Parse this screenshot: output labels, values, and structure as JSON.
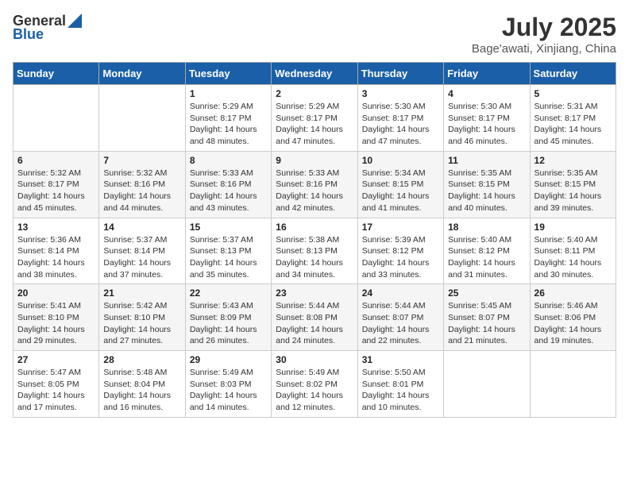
{
  "logo": {
    "general": "General",
    "blue": "Blue"
  },
  "title": "July 2025",
  "location": "Bage'awati, Xinjiang, China",
  "days_of_week": [
    "Sunday",
    "Monday",
    "Tuesday",
    "Wednesday",
    "Thursday",
    "Friday",
    "Saturday"
  ],
  "weeks": [
    [
      {
        "day": "",
        "info": ""
      },
      {
        "day": "",
        "info": ""
      },
      {
        "day": "1",
        "info": "Sunrise: 5:29 AM\nSunset: 8:17 PM\nDaylight: 14 hours and 48 minutes."
      },
      {
        "day": "2",
        "info": "Sunrise: 5:29 AM\nSunset: 8:17 PM\nDaylight: 14 hours and 47 minutes."
      },
      {
        "day": "3",
        "info": "Sunrise: 5:30 AM\nSunset: 8:17 PM\nDaylight: 14 hours and 47 minutes."
      },
      {
        "day": "4",
        "info": "Sunrise: 5:30 AM\nSunset: 8:17 PM\nDaylight: 14 hours and 46 minutes."
      },
      {
        "day": "5",
        "info": "Sunrise: 5:31 AM\nSunset: 8:17 PM\nDaylight: 14 hours and 45 minutes."
      }
    ],
    [
      {
        "day": "6",
        "info": "Sunrise: 5:32 AM\nSunset: 8:17 PM\nDaylight: 14 hours and 45 minutes."
      },
      {
        "day": "7",
        "info": "Sunrise: 5:32 AM\nSunset: 8:16 PM\nDaylight: 14 hours and 44 minutes."
      },
      {
        "day": "8",
        "info": "Sunrise: 5:33 AM\nSunset: 8:16 PM\nDaylight: 14 hours and 43 minutes."
      },
      {
        "day": "9",
        "info": "Sunrise: 5:33 AM\nSunset: 8:16 PM\nDaylight: 14 hours and 42 minutes."
      },
      {
        "day": "10",
        "info": "Sunrise: 5:34 AM\nSunset: 8:15 PM\nDaylight: 14 hours and 41 minutes."
      },
      {
        "day": "11",
        "info": "Sunrise: 5:35 AM\nSunset: 8:15 PM\nDaylight: 14 hours and 40 minutes."
      },
      {
        "day": "12",
        "info": "Sunrise: 5:35 AM\nSunset: 8:15 PM\nDaylight: 14 hours and 39 minutes."
      }
    ],
    [
      {
        "day": "13",
        "info": "Sunrise: 5:36 AM\nSunset: 8:14 PM\nDaylight: 14 hours and 38 minutes."
      },
      {
        "day": "14",
        "info": "Sunrise: 5:37 AM\nSunset: 8:14 PM\nDaylight: 14 hours and 37 minutes."
      },
      {
        "day": "15",
        "info": "Sunrise: 5:37 AM\nSunset: 8:13 PM\nDaylight: 14 hours and 35 minutes."
      },
      {
        "day": "16",
        "info": "Sunrise: 5:38 AM\nSunset: 8:13 PM\nDaylight: 14 hours and 34 minutes."
      },
      {
        "day": "17",
        "info": "Sunrise: 5:39 AM\nSunset: 8:12 PM\nDaylight: 14 hours and 33 minutes."
      },
      {
        "day": "18",
        "info": "Sunrise: 5:40 AM\nSunset: 8:12 PM\nDaylight: 14 hours and 31 minutes."
      },
      {
        "day": "19",
        "info": "Sunrise: 5:40 AM\nSunset: 8:11 PM\nDaylight: 14 hours and 30 minutes."
      }
    ],
    [
      {
        "day": "20",
        "info": "Sunrise: 5:41 AM\nSunset: 8:10 PM\nDaylight: 14 hours and 29 minutes."
      },
      {
        "day": "21",
        "info": "Sunrise: 5:42 AM\nSunset: 8:10 PM\nDaylight: 14 hours and 27 minutes."
      },
      {
        "day": "22",
        "info": "Sunrise: 5:43 AM\nSunset: 8:09 PM\nDaylight: 14 hours and 26 minutes."
      },
      {
        "day": "23",
        "info": "Sunrise: 5:44 AM\nSunset: 8:08 PM\nDaylight: 14 hours and 24 minutes."
      },
      {
        "day": "24",
        "info": "Sunrise: 5:44 AM\nSunset: 8:07 PM\nDaylight: 14 hours and 22 minutes."
      },
      {
        "day": "25",
        "info": "Sunrise: 5:45 AM\nSunset: 8:07 PM\nDaylight: 14 hours and 21 minutes."
      },
      {
        "day": "26",
        "info": "Sunrise: 5:46 AM\nSunset: 8:06 PM\nDaylight: 14 hours and 19 minutes."
      }
    ],
    [
      {
        "day": "27",
        "info": "Sunrise: 5:47 AM\nSunset: 8:05 PM\nDaylight: 14 hours and 17 minutes."
      },
      {
        "day": "28",
        "info": "Sunrise: 5:48 AM\nSunset: 8:04 PM\nDaylight: 14 hours and 16 minutes."
      },
      {
        "day": "29",
        "info": "Sunrise: 5:49 AM\nSunset: 8:03 PM\nDaylight: 14 hours and 14 minutes."
      },
      {
        "day": "30",
        "info": "Sunrise: 5:49 AM\nSunset: 8:02 PM\nDaylight: 14 hours and 12 minutes."
      },
      {
        "day": "31",
        "info": "Sunrise: 5:50 AM\nSunset: 8:01 PM\nDaylight: 14 hours and 10 minutes."
      },
      {
        "day": "",
        "info": ""
      },
      {
        "day": "",
        "info": ""
      }
    ]
  ]
}
